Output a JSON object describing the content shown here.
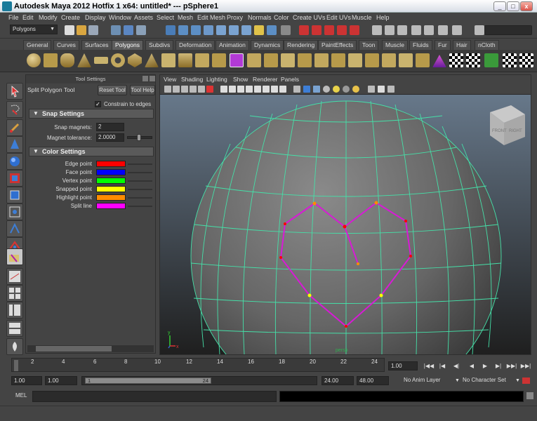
{
  "titlebar": {
    "title": "Autodesk Maya 2012 Hotfix 1 x64: untitled*   ---   pSphere1",
    "minimize": "_",
    "maximize": "□",
    "close": "x"
  },
  "menubar": [
    "File",
    "Edit",
    "Modify",
    "Create",
    "Display",
    "Window",
    "Assets",
    "Select",
    "Mesh",
    "Edit Mesh",
    "Proxy",
    "Normals",
    "Color",
    "Create UVs",
    "Edit UVs",
    "Muscle",
    "Help"
  ],
  "statusline": {
    "mode": "Polygons"
  },
  "shelf": {
    "tabs": [
      "General",
      "Curves",
      "Surfaces",
      "Polygons",
      "Subdivs",
      "Deformation",
      "Animation",
      "Dynamics",
      "Rendering",
      "PaintEffects",
      "Toon",
      "Muscle",
      "Fluids",
      "Fur",
      "Hair",
      "nCloth"
    ],
    "active": "Polygons"
  },
  "tool_settings": {
    "panel_title": "Tool Settings",
    "tool_name": "Split Polygon Tool",
    "reset_button": "Reset Tool",
    "help_button": "Tool Help",
    "constrain_label": "Constrain to edges",
    "constrain_checked": true,
    "constrain_mark": "✓",
    "snap_frame": "Snap Settings",
    "snap_magnets_label": "Snap magnets:",
    "snap_magnets_value": "2",
    "magnet_tolerance_label": "Magnet tolerance:",
    "magnet_tolerance_value": "2.0000",
    "color_frame": "Color Settings",
    "colors": [
      {
        "label": "Edge point",
        "color": "#ff0000"
      },
      {
        "label": "Face point",
        "color": "#0000ff"
      },
      {
        "label": "Vertex point",
        "color": "#00ff00"
      },
      {
        "label": "Snapped point",
        "color": "#ffff00"
      },
      {
        "label": "Highlight point",
        "color": "#ff8c00"
      },
      {
        "label": "Split line",
        "color": "#ff00ff"
      }
    ]
  },
  "viewport": {
    "menu": [
      "View",
      "Shading",
      "Lighting",
      "Show",
      "Renderer",
      "Panels"
    ],
    "cube_front": "FRONT",
    "cube_right": "RIGHT",
    "camera_label": "persp",
    "axis_x": "x",
    "axis_y": "y"
  },
  "timeline": {
    "ticks": [
      "2",
      "4",
      "6",
      "8",
      "10",
      "12",
      "14",
      "16",
      "18",
      "20",
      "22",
      "24"
    ],
    "start_label": "1",
    "current_frame": "1.00",
    "playback": [
      "|◀◀",
      "|◀",
      "◀|",
      "◀",
      "▶",
      "▶|",
      "▶▶|",
      "▶▶|"
    ]
  },
  "range": {
    "start": "1.00",
    "playback_start": "1.00",
    "handle_start": "1",
    "handle_end": "24",
    "playback_end": "24.00",
    "end": "48.00",
    "anim_layer": "No Anim Layer",
    "character_set": "No Character Set"
  },
  "command": {
    "label": "MEL"
  }
}
